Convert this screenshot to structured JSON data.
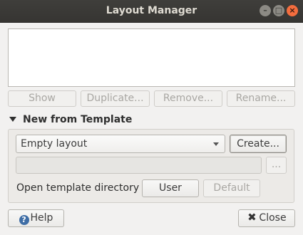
{
  "window": {
    "title": "Layout Manager"
  },
  "list_actions": {
    "show": "Show",
    "duplicate": "Duplicate...",
    "remove": "Remove...",
    "rename": "Rename..."
  },
  "template_section": {
    "header": "New from Template",
    "selected_template": "Empty layout",
    "create": "Create...",
    "browse": "...",
    "open_dir_label": "Open template directory",
    "user": "User",
    "default": "Default"
  },
  "footer": {
    "help": "Help",
    "close": "Close"
  }
}
